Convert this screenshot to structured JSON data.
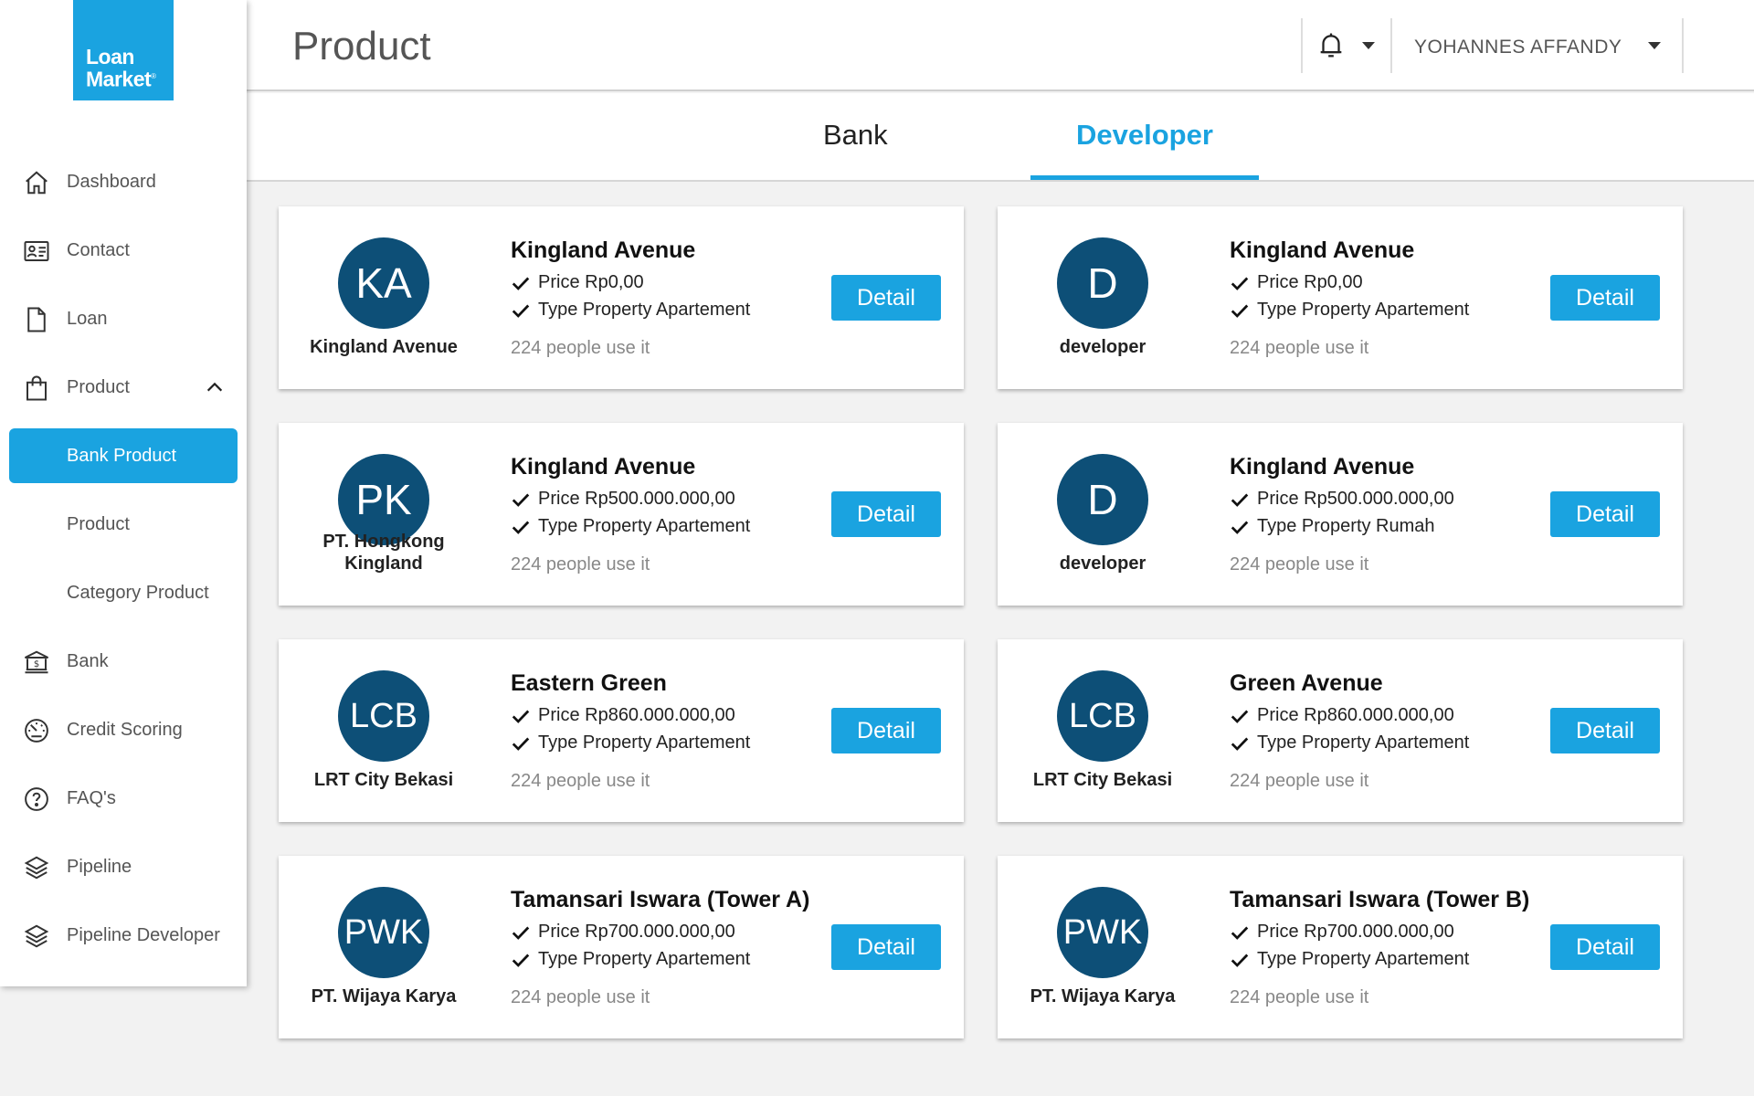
{
  "brand": {
    "logo_line1": "Loan",
    "logo_line2": "Market",
    "logo_tm": "®",
    "color": "#1aa3e0"
  },
  "sidebar": {
    "items": [
      {
        "label": "Dashboard",
        "icon": "home-icon"
      },
      {
        "label": "Contact",
        "icon": "contact-card-icon"
      },
      {
        "label": "Loan",
        "icon": "document-icon"
      },
      {
        "label": "Product",
        "icon": "shopping-bag-icon",
        "expanded": true,
        "children": [
          {
            "label": "Bank Product",
            "active": true
          },
          {
            "label": "Product"
          },
          {
            "label": "Category Product"
          }
        ]
      },
      {
        "label": "Bank",
        "icon": "bank-icon"
      },
      {
        "label": "Credit Scoring",
        "icon": "gauge-icon"
      },
      {
        "label": "FAQ's",
        "icon": "question-icon"
      },
      {
        "label": "Pipeline",
        "icon": "layers-icon"
      },
      {
        "label": "Pipeline Developer",
        "icon": "layers-icon"
      }
    ]
  },
  "header": {
    "title": "Product",
    "user_name": "YOHANNES AFFANDY"
  },
  "tabs": [
    {
      "label": "Bank",
      "active": false
    },
    {
      "label": "Developer",
      "active": true
    }
  ],
  "cards": [
    {
      "initials": "KA",
      "avatar_name": "Kingland Avenue",
      "title": "Kingland Avenue",
      "price": "Price Rp0,00",
      "type": "Type Property Apartement",
      "users": "224 people use it",
      "button": "Detail"
    },
    {
      "initials": "D",
      "avatar_name": "developer",
      "title": "Kingland Avenue",
      "price": "Price Rp0,00",
      "type": "Type Property Apartement",
      "users": "224 people use it",
      "button": "Detail"
    },
    {
      "initials": "PK",
      "avatar_name": "PT. Hongkong Kingland",
      "title": "Kingland Avenue",
      "price": "Price Rp500.000.000,00",
      "type": "Type Property Apartement",
      "users": "224 people use it",
      "button": "Detail"
    },
    {
      "initials": "D",
      "avatar_name": "developer",
      "title": "Kingland Avenue",
      "price": "Price Rp500.000.000,00",
      "type": "Type Property Rumah",
      "users": "224 people use it",
      "button": "Detail"
    },
    {
      "initials": "LCB",
      "avatar_name": "LRT City Bekasi",
      "title": "Eastern Green",
      "price": "Price Rp860.000.000,00",
      "type": "Type Property Apartement",
      "users": "224 people use it",
      "button": "Detail"
    },
    {
      "initials": "LCB",
      "avatar_name": "LRT City Bekasi",
      "title": "Green Avenue",
      "price": "Price Rp860.000.000,00",
      "type": "Type Property Apartement",
      "users": "224 people use it",
      "button": "Detail"
    },
    {
      "initials": "PWK",
      "avatar_name": "PT. Wijaya Karya",
      "title": "Tamansari Iswara (Tower A)",
      "price": "Price Rp700.000.000,00",
      "type": "Type Property Apartement",
      "users": "224 people use it",
      "button": "Detail"
    },
    {
      "initials": "PWK",
      "avatar_name": "PT. Wijaya Karya",
      "title": "Tamansari Iswara (Tower B)",
      "price": "Price Rp700.000.000,00",
      "type": "Type Property Apartement",
      "users": "224 people use it",
      "button": "Detail"
    }
  ]
}
